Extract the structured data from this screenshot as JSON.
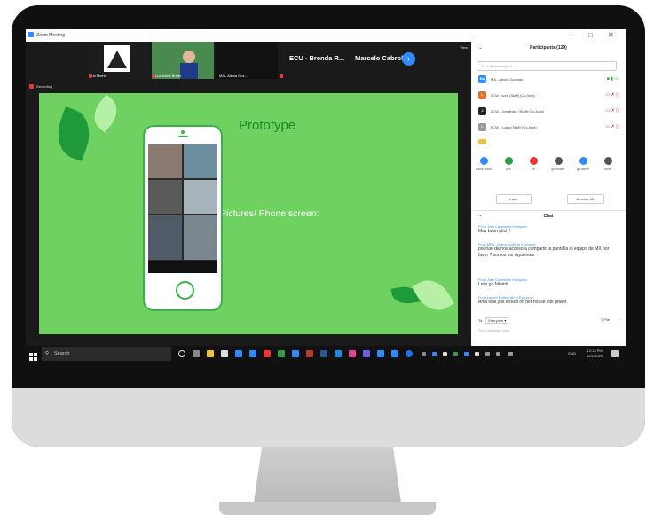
{
  "window": {
    "app_title": "Zoom Meeting",
    "recording_label": "Recording",
    "view_label": "View"
  },
  "gallery": {
    "tiles": [
      {
        "name": "Ux Meetr"
      },
      {
        "name": "Luz Marie Buffer"
      },
      {
        "name": "MA - Alexia Guz..."
      }
    ],
    "name_tiles": [
      "ECU - Brenda R...",
      "Marcelo Cabrol"
    ]
  },
  "slide": {
    "title": "Prototype",
    "body": "Pictures/ Phone screen:"
  },
  "taskbar": {
    "search_label": "Search",
    "lang": "ENG",
    "time": "12:13 PM",
    "date": "12/1/2020"
  },
  "participants": {
    "header": "Participants (129)",
    "search_placeholder": "Find a participant",
    "rows": [
      {
        "initials": "MA",
        "name": "MA - Alexia Guzman",
        "color": "#2d8cff"
      },
      {
        "initials": "L",
        "name": "LCW - Ivan (Staff) (Co-host)",
        "color": "#e8722a"
      },
      {
        "initials": "J",
        "name": "LCW - Jonathan- (Staff) (Co-host)",
        "color": "#222222"
      },
      {
        "initials": "L",
        "name": "LCW - Luisa (Staff) (Co-host)",
        "color": "#999999"
      }
    ],
    "actions": [
      "Raise Hand",
      "yes",
      "no",
      "go slower",
      "go faster",
      "more"
    ],
    "invite_label": "Invite",
    "unmute_label": "Unmute Me"
  },
  "chat": {
    "header": "Chat",
    "messages": [
      {
        "from": "From Jose Caceres to Everyone:",
        "text": "May buen pitch !"
      },
      {
        "from": "From MEX - Diana Acuña to Everyone:",
        "text": "podrian darnos acceso a compartir la pantalla al equipo de MX por favor ? somos los siguientes"
      },
      {
        "from": "From Jose Caceres to Everyone:",
        "text": "Let's go Miami!"
      },
      {
        "from": "From Lauren Rothschild to Everyone:",
        "text": "Ania was just kicked off her house lost power."
      }
    ],
    "to_label": "To:",
    "recipient": "Everyone",
    "file_label": "File",
    "input_placeholder": "Type message here..."
  },
  "colors": {
    "slide_bg": "#6fd15f",
    "accent": "#2d8cff",
    "title_green": "#1f8a2a"
  }
}
